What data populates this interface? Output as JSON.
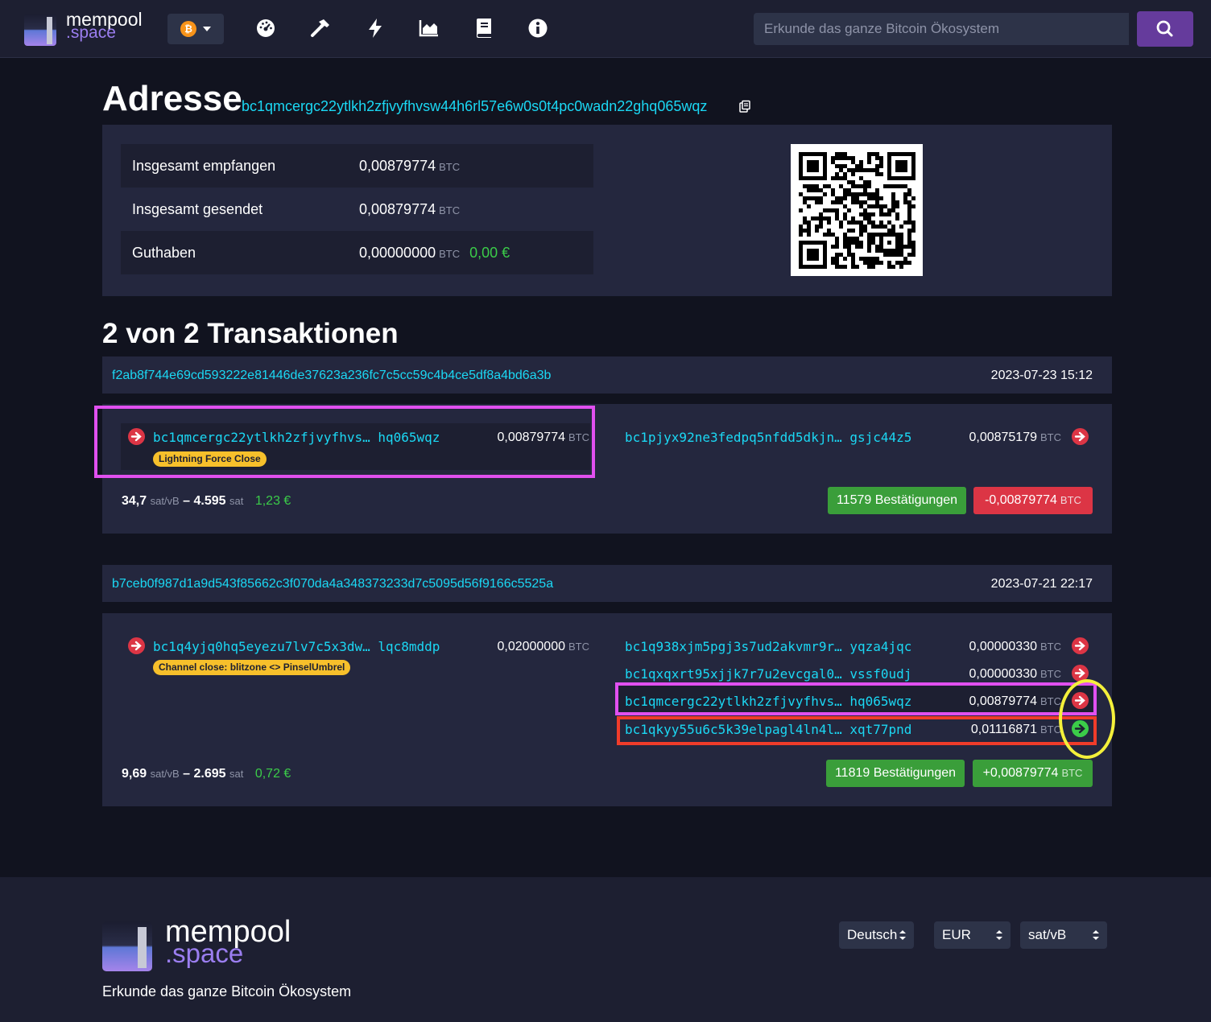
{
  "header": {
    "logo_line1": "mempool",
    "logo_line2": ".space",
    "network_symbol": "₿",
    "nav_icons": [
      "dashboard-icon",
      "mining-hammer-icon",
      "lightning-icon",
      "graphs-icon",
      "docs-book-icon",
      "about-info-icon"
    ],
    "search_placeholder": "Erkunde das ganze Bitcoin Ökosystem"
  },
  "address": {
    "title": "Adresse",
    "value": "bc1qmcergc22ytlkh2zfjvyfhvsw44h6rl57e6w0s0t4pc0wadn22ghq065wqz",
    "stats": [
      {
        "label": "Insgesamt empfangen",
        "value": "0,00879774",
        "unit": "BTC"
      },
      {
        "label": "Insgesamt gesendet",
        "value": "0,00879774",
        "unit": "BTC"
      },
      {
        "label": "Guthaben",
        "value": "0,00000000",
        "unit": "BTC",
        "fiat": "0,00 €"
      }
    ]
  },
  "tx_count_label": "2 von 2 Transaktionen",
  "transactions": [
    {
      "txid": "f2ab8f744e69cd593222e81446de37623a236fc7c5cc59c4b4ce5df8a4bd6a3b",
      "time": "2023-07-23 15:12",
      "inputs": [
        {
          "addr_start": "bc1qmcergc22ytlkh2zfjvyfhvs…",
          "addr_end": "hq065wqz",
          "amount": "0,00879774",
          "unit": "BTC",
          "tag": "Lightning Force Close"
        }
      ],
      "outputs": [
        {
          "addr_start": "bc1pjyx92ne3fedpq5nfdd5dkjn…",
          "addr_end": "gsjc44z5",
          "amount": "0,00875179",
          "unit": "BTC"
        }
      ],
      "fee_rate": "34,7",
      "fee_rate_unit": "sat/vB",
      "fee_sep": "–",
      "fee": "4.595",
      "fee_unit": "sat",
      "fee_fiat": "1,23 €",
      "confirmations": "11579 Bestätigungen",
      "net_amount": "-0,00879774",
      "net_unit": "BTC"
    },
    {
      "txid": "b7ceb0f987d1a9d543f85662c3f070da4a348373233d7c5095d56f9166c5525a",
      "time": "2023-07-21 22:17",
      "inputs": [
        {
          "addr_start": "bc1q4yjq0hq5eyezu7lv7c5x3dw…",
          "addr_end": "lqc8mddp",
          "amount": "0,02000000",
          "unit": "BTC",
          "tag": "Channel close: blitzone <> PinselUmbrel"
        }
      ],
      "outputs": [
        {
          "addr_start": "bc1q938xjm5pgj3s7ud2akvmr9r…",
          "addr_end": "yqza4jqc",
          "amount": "0,00000330",
          "unit": "BTC"
        },
        {
          "addr_start": "bc1qxqxrt95xjjk7r7u2evcgal0…",
          "addr_end": "vssf0udj",
          "amount": "0,00000330",
          "unit": "BTC"
        },
        {
          "addr_start": "bc1qmcergc22ytlkh2zfjvyfhvs…",
          "addr_end": "hq065wqz",
          "amount": "0,00879774",
          "unit": "BTC"
        },
        {
          "addr_start": "bc1qkyy55u6c5k39elpagl4ln4l…",
          "addr_end": "xqt77pnd",
          "amount": "0,01116871",
          "unit": "BTC"
        }
      ],
      "fee_rate": "9,69",
      "fee_rate_unit": "sat/vB",
      "fee_sep": "–",
      "fee": "2.695",
      "fee_unit": "sat",
      "fee_fiat": "0,72 €",
      "confirmations": "11819 Bestätigungen",
      "net_amount": "+0,00879774",
      "net_unit": "BTC"
    }
  ],
  "footer": {
    "logo_line1": "mempool",
    "logo_line2": ".space",
    "tagline": "Erkunde das ganze Bitcoin Ökosystem",
    "language": "Deutsch",
    "currency": "EUR",
    "fee_unit": "sat/vB"
  },
  "colors": {
    "background": "#11131f",
    "panel": "#24273e",
    "link": "#1bd8f4",
    "accent_purple": "#653b9c",
    "success": "#3a9e3a",
    "danger": "#dc3545",
    "tag_yellow": "#f7c02b",
    "annotation_magenta": "#e150f0",
    "annotation_red": "#f03c2a",
    "annotation_yellow": "#f4f03a"
  }
}
